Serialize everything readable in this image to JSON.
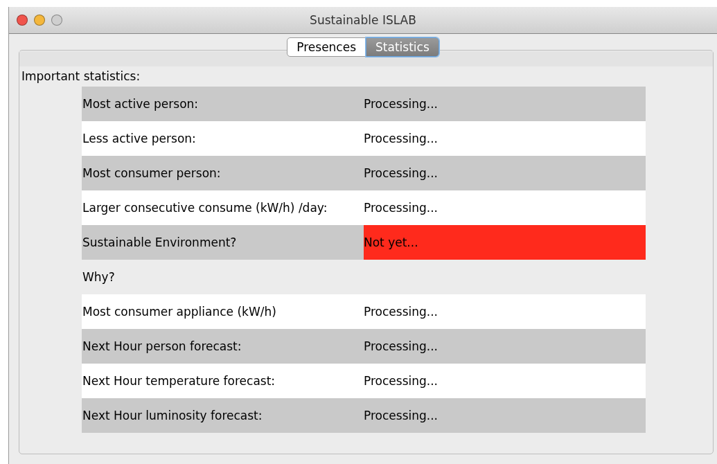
{
  "window": {
    "title": "Sustainable ISLAB"
  },
  "tabs": [
    {
      "label": "Presences",
      "selected": false
    },
    {
      "label": "Statistics",
      "selected": true
    }
  ],
  "heading": "Important statistics:",
  "rows": [
    {
      "kind": "shaded",
      "label": "Most active person:",
      "value": "Processing...",
      "alert": false
    },
    {
      "kind": "white",
      "label": "Less active person:",
      "value": "Processing...",
      "alert": false
    },
    {
      "kind": "shaded",
      "label": "Most consumer person:",
      "value": "Processing...",
      "alert": false
    },
    {
      "kind": "white",
      "label": "Larger consecutive consume (kW/h) /day:",
      "value": "Processing...",
      "alert": false
    },
    {
      "kind": "shaded",
      "label": "Sustainable Environment?",
      "value": "Not yet...",
      "alert": true
    },
    {
      "kind": "plain",
      "label": "Why?",
      "alert": false
    },
    {
      "kind": "white",
      "label": "Most consumer appliance (kW/h)",
      "value": "Processing...",
      "alert": false
    },
    {
      "kind": "shaded",
      "label": "Next Hour person forecast:",
      "value": "Processing...",
      "alert": false
    },
    {
      "kind": "white",
      "label": "Next Hour temperature forecast:",
      "value": "Processing...",
      "alert": false
    },
    {
      "kind": "shaded",
      "label": "Next Hour luminosity forecast:",
      "value": "Processing...",
      "alert": false
    }
  ]
}
